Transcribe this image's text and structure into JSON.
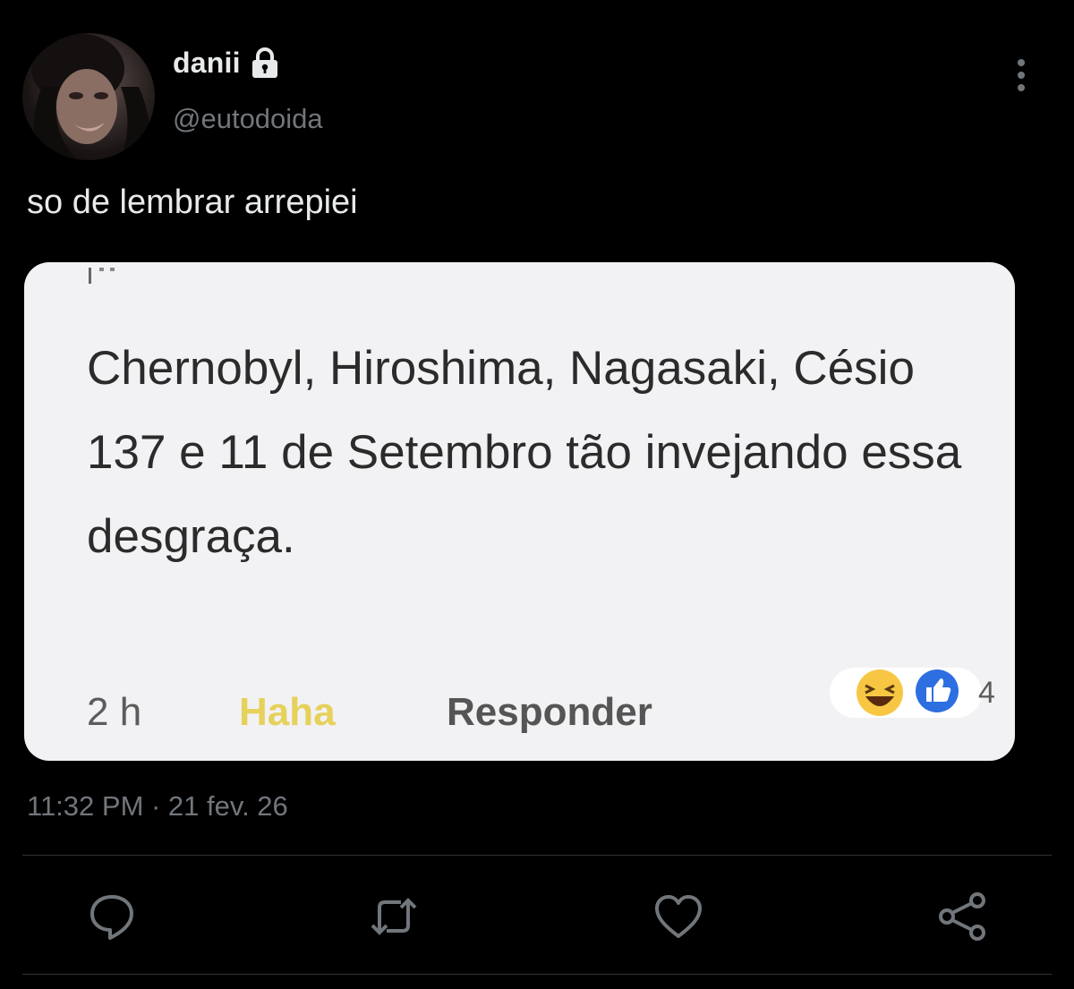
{
  "author": {
    "display_name": "danii",
    "handle": "@eutodoida",
    "protected_icon": "lock-icon",
    "avatar": "avatar"
  },
  "tweet": {
    "text": "so de lembrar arrepiei",
    "timestamp": "11:32 PM · 21 fev. 26"
  },
  "media": {
    "comment_text": "Chernobyl, Hiroshima, Nagasaki, Césio 137 e 11 de Setembro tão invejando essa desgraça.",
    "comment_time": "2 h",
    "reaction_label": "Haha",
    "reply_label": "Responder",
    "reaction_count": "4",
    "reaction_icons": [
      "haha-emoji-icon",
      "like-icon"
    ]
  },
  "actions": {
    "icons": [
      "reply-icon",
      "retweet-icon",
      "like-icon",
      "share-icon"
    ]
  },
  "colors": {
    "background": "#000000",
    "text_primary": "#e7e9ea",
    "text_secondary": "#71767b",
    "divider": "#2f3336",
    "haha_yellow": "#e6d15a",
    "like_blue": "#2d6fe0"
  }
}
